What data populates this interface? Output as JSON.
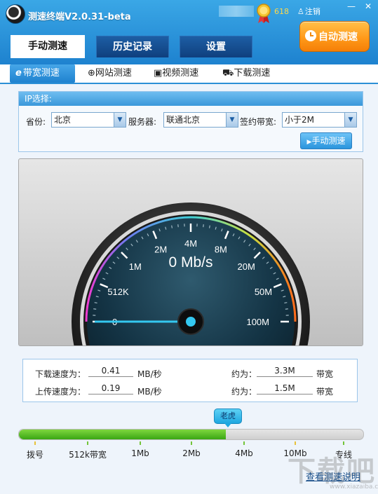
{
  "app": {
    "title": "测速终端V2.0.31-beta",
    "level": "618",
    "logout_label": "注销",
    "minimize_label": "—",
    "close_label": "✕"
  },
  "main_tabs": [
    {
      "label": "手动测速",
      "active": true
    },
    {
      "label": "历史记录",
      "active": false
    },
    {
      "label": "设置",
      "active": false
    }
  ],
  "auto_button": {
    "label": "自动测速"
  },
  "sub_tabs": [
    {
      "label": "带宽测速",
      "icon": "e-icon",
      "active": true
    },
    {
      "label": "网站测速",
      "icon": "globe-icon",
      "active": false
    },
    {
      "label": "视频测速",
      "icon": "video-camera-icon",
      "active": false
    },
    {
      "label": "下载测速",
      "icon": "car-icon",
      "active": false
    }
  ],
  "ip_panel": {
    "header": "IP选择:",
    "province_label": "省份:",
    "province_value": "北京",
    "server_label": "服务器:",
    "server_value": "联通北京",
    "bandwidth_label": "签约带宽:",
    "bandwidth_value": "小于2M",
    "manual_button": "手动测速"
  },
  "gauge": {
    "reading": "0 Mb/s",
    "scale_labels": [
      "0",
      "512K",
      "1M",
      "2M",
      "4M",
      "8M",
      "20M",
      "50M",
      "100M"
    ],
    "needle_value": "0"
  },
  "results": {
    "download_label": "下载速度为：",
    "download_value": "0.41",
    "download_unit": "MB/秒",
    "download_about": "约为：",
    "download_bandwidth": "3.3M",
    "download_suffix": "带宽",
    "upload_label": "上传速度为：",
    "upload_value": "0.19",
    "upload_unit": "MB/秒",
    "upload_about": "约为：",
    "upload_bandwidth": "1.5M",
    "upload_suffix": "带宽"
  },
  "level_bar": {
    "badge": "老虎",
    "fill_fraction": 0.6,
    "ticks": [
      "拨号",
      "512k带宽",
      "1Mb",
      "2Mb",
      "4Mb",
      "10Mb",
      "专线"
    ]
  },
  "help_link": "查看测速说明",
  "watermark": "下载吧",
  "watermark_url": "www.xiazaiba.com",
  "colors": {
    "title_bar": "#1e82cf",
    "tab_dark": "#0f3f7e",
    "auto_button": "#ff9a1a",
    "gauge_dial": "#0f2f40",
    "needle": "#34c8f0",
    "bar_fill": "#3aa613"
  }
}
